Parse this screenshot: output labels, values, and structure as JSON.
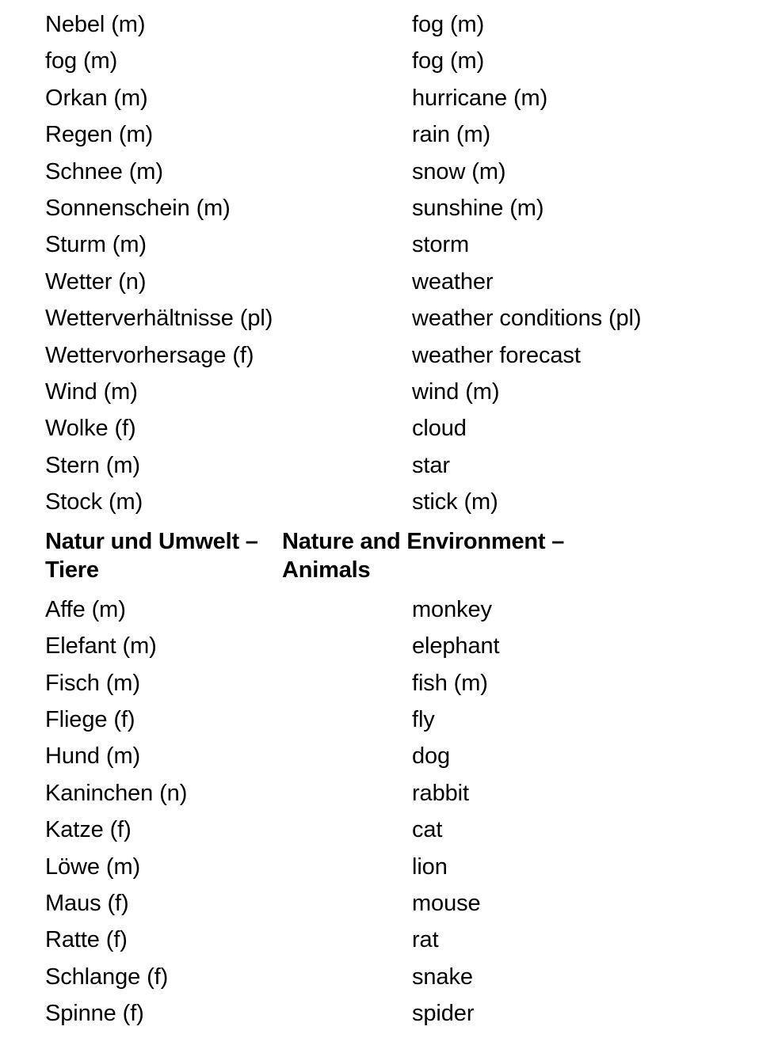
{
  "document": {
    "type": "bilingual-glossary",
    "source_language": "German",
    "target_language": "English",
    "entries": [
      {
        "kind": "entry",
        "source": "Nebel (m)",
        "target": "fog (m)"
      },
      {
        "kind": "entry",
        "source": "fog (m)",
        "target": "fog (m)"
      },
      {
        "kind": "entry",
        "source": "Orkan (m)",
        "target": "hurricane (m)"
      },
      {
        "kind": "entry",
        "source": "Regen (m)",
        "target": "rain (m)"
      },
      {
        "kind": "entry",
        "source": "Schnee (m)",
        "target": "snow (m)"
      },
      {
        "kind": "entry",
        "source": "Sonnenschein (m)",
        "target": "sunshine (m)"
      },
      {
        "kind": "entry",
        "source": "Sturm (m)",
        "target": "storm"
      },
      {
        "kind": "entry",
        "source": "Wetter (n)",
        "target": "weather"
      },
      {
        "kind": "entry",
        "source": "Wetterverhältnisse (pl)",
        "target": "weather conditions (pl)"
      },
      {
        "kind": "entry",
        "source": "Wettervorhersage (f)",
        "target": "weather forecast"
      },
      {
        "kind": "entry",
        "source": "Wind (m)",
        "target": "wind (m)"
      },
      {
        "kind": "entry",
        "source": "Wolke (f)",
        "target": "cloud"
      },
      {
        "kind": "entry",
        "source": "Stern (m)",
        "target": "star"
      },
      {
        "kind": "entry",
        "source": "Stock (m)",
        "target": "stick (m)"
      },
      {
        "kind": "header",
        "source": "Natur und Umwelt – Tiere",
        "target": "Nature and Environment – Animals"
      },
      {
        "kind": "entry",
        "source": "Affe (m)",
        "target": "monkey"
      },
      {
        "kind": "entry",
        "source": "Elefant (m)",
        "target": "elephant"
      },
      {
        "kind": "entry",
        "source": "Fisch (m)",
        "target": "fish (m)"
      },
      {
        "kind": "entry",
        "source": "Fliege (f)",
        "target": "fly"
      },
      {
        "kind": "entry",
        "source": "Hund (m)",
        "target": "dog"
      },
      {
        "kind": "entry",
        "source": "Kaninchen (n)",
        "target": "rabbit"
      },
      {
        "kind": "entry",
        "source": "Katze (f)",
        "target": "cat"
      },
      {
        "kind": "entry",
        "source": "Löwe (m)",
        "target": "lion"
      },
      {
        "kind": "entry",
        "source": "Maus (f)",
        "target": "mouse"
      },
      {
        "kind": "entry",
        "source": "Ratte (f)",
        "target": "rat"
      },
      {
        "kind": "entry",
        "source": "Schlange (f)",
        "target": "snake"
      },
      {
        "kind": "entry",
        "source": "Spinne (f)",
        "target": "spider"
      }
    ]
  }
}
